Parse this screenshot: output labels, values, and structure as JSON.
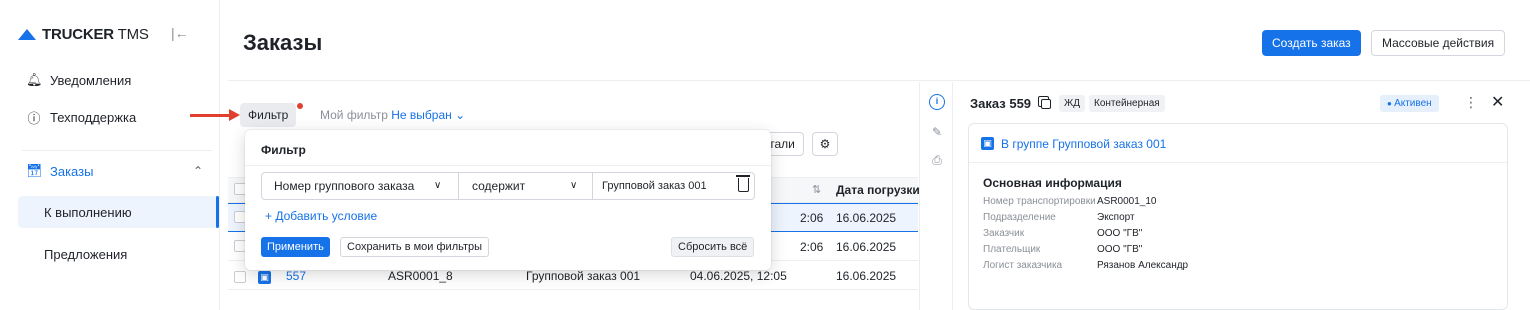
{
  "app": {
    "logo_bold": "TRUCKER",
    "logo_rest": " TMS"
  },
  "sidebar": {
    "collapse_glyph": "|←",
    "items": [
      {
        "label": "Уведомления"
      },
      {
        "label": "Техподдержка"
      },
      {
        "label": "Заказы"
      }
    ],
    "sub_items": [
      {
        "label": "К выполнению"
      },
      {
        "label": "Предложения"
      }
    ]
  },
  "header": {
    "title": "Заказы",
    "create_label": "Создать заказ",
    "bulk_label": "Массовые действия"
  },
  "filter_bar": {
    "filter_label": "Фильтр",
    "my_filter_label": "Мой фильтр",
    "my_filter_value": "Не выбран"
  },
  "table": {
    "partial_btn": "тали",
    "col_date": "Дата погрузки",
    "rows": [
      {
        "time": "2:06",
        "load_date": "16.06.2025"
      },
      {
        "time": "2:06",
        "load_date": "16.06.2025"
      },
      {
        "id": "557",
        "transport_no": "ASR0001_8",
        "group": "Групповой заказ 001",
        "created": "04.06.2025, 12:05",
        "load_date": "16.06.2025"
      }
    ]
  },
  "filter_popup": {
    "title": "Фильтр",
    "field": "Номер группового заказа",
    "operator": "содержит",
    "value": "Групповой заказ 001",
    "add_condition": "+ Добавить условие",
    "apply": "Применить",
    "save": "Сохранить в мои фильтры",
    "reset": "Сбросить всё"
  },
  "details": {
    "title": "Заказ 559",
    "tag_rail": "ЖД",
    "tag_type": "Контейнерная",
    "status": "Активен",
    "group_link": "В группе Групповой заказ 001",
    "section_title": "Основная информация",
    "fields": [
      {
        "k": "Номер транспортировки",
        "v": "ASR0001_10"
      },
      {
        "k": "Подразделение",
        "v": "Экспорт"
      },
      {
        "k": "Заказчик",
        "v": "ООО \"ГВ\""
      },
      {
        "k": "Плательщик",
        "v": "ООО \"ГВ\""
      },
      {
        "k": "Логист заказчика",
        "v": "Рязанов Александр"
      }
    ]
  },
  "colors": {
    "accent": "#1672e8",
    "arrow": "#e0412f"
  }
}
